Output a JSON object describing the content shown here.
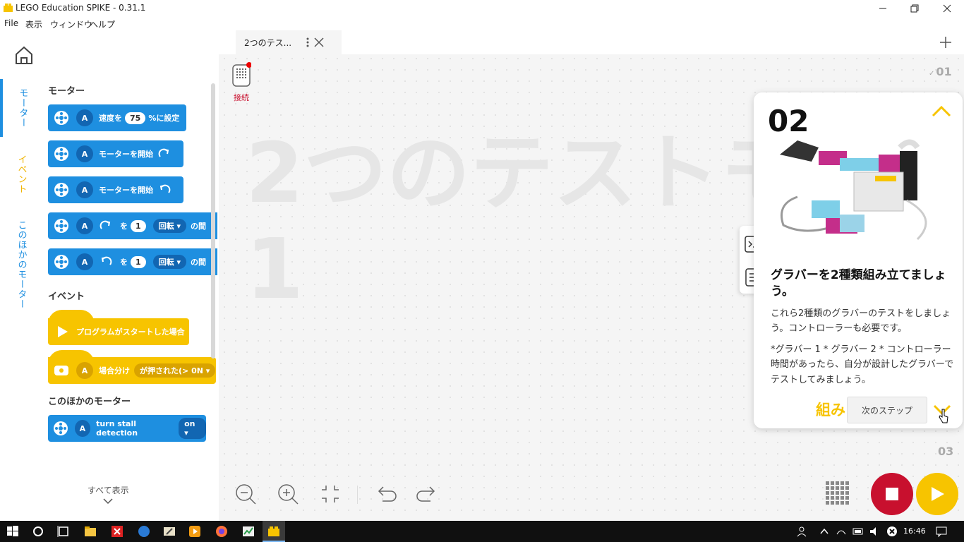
{
  "window": {
    "title": "LEGO Education SPIKE - 0.31.1"
  },
  "menu": [
    "File",
    "表示",
    "ウィンドウ",
    "ヘルプ"
  ],
  "sidebar": {
    "tabs": [
      {
        "label": "モーター",
        "active": true
      },
      {
        "label": "イベント",
        "active": false
      },
      {
        "label": "このほかのモーター",
        "active": false
      }
    ]
  },
  "palette": {
    "sections": {
      "motors": "モーター",
      "events": "イベント",
      "more_motors": "このほかのモーター"
    },
    "blocks": {
      "set_speed": {
        "port": "A",
        "prefix": "速度を",
        "value": "75",
        "suffix": "%に設定"
      },
      "start_cw": {
        "port": "A",
        "text": "モーターを開始"
      },
      "start_ccw": {
        "port": "A",
        "text": "モーターを開始"
      },
      "run_cw": {
        "port": "A",
        "mid": "を",
        "value": "1",
        "unit": "回転",
        "tail": "の間"
      },
      "run_ccw": {
        "port": "A",
        "mid": "を",
        "value": "1",
        "unit": "回転",
        "tail": "の間"
      },
      "program_start": {
        "text": "プログラムがスタートした場合"
      },
      "when_pressed": {
        "port": "A",
        "text": "場合分け",
        "dropdown": "が押された(> 0N"
      },
      "stall": {
        "port": "A",
        "text": "turn stall detection",
        "dropdown": "on"
      }
    },
    "show_all": "すべて表示"
  },
  "editor": {
    "tab_label": "2つのテス...",
    "connect_label": "接続",
    "project_title_line1": "2つのテストモ",
    "project_title_line2": "1",
    "steps": {
      "prev": "01",
      "next": "03"
    }
  },
  "step_card": {
    "number": "02",
    "heading": "グラバーを2種類組み立てましょう。",
    "body1": "これら2種類のグラバーのテストをしましょう。コントローラーも必要です。",
    "body2": "*グラバー 1 * グラバー 2 * コントローラー 時間があったら、自分が設計したグラバーでテストしてみましょう。",
    "assemble_label": "組み",
    "next_step_label": "次のステップ"
  },
  "taskbar": {
    "time": "16:46"
  },
  "colors": {
    "blue": "#1e8fe0",
    "yellow": "#f7c400",
    "red": "#c8102e"
  }
}
